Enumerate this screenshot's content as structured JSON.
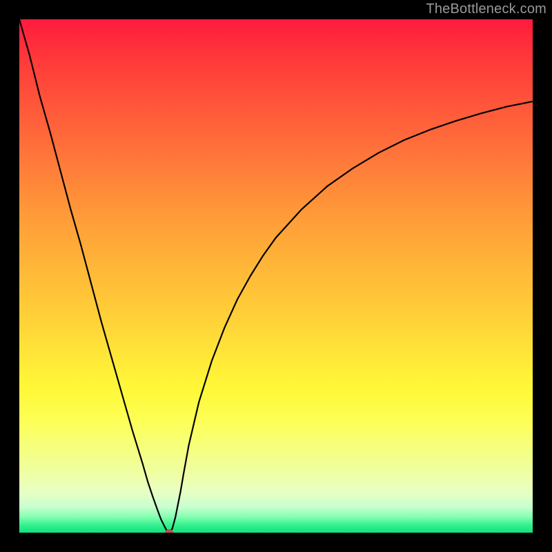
{
  "watermark": "TheBottleneck.com",
  "colors": {
    "frame": "#000000",
    "curve": "#000000",
    "dot": "#c05048"
  },
  "chart_data": {
    "type": "line",
    "title": "",
    "xlabel": "",
    "ylabel": "",
    "xlim": [
      0,
      100
    ],
    "ylim": [
      0,
      100
    ],
    "grid": false,
    "legend": false,
    "annotations": [
      {
        "type": "marker",
        "x": 29.2,
        "y": 0,
        "shape": "dot"
      }
    ],
    "series": [
      {
        "name": "curve",
        "x": [
          0.0,
          2.0,
          4.0,
          6.0,
          8.0,
          10.0,
          12.0,
          14.0,
          16.0,
          18.0,
          20.0,
          22.0,
          24.0,
          25.0,
          26.0,
          27.0,
          27.6,
          28.6,
          29.2,
          29.8,
          30.4,
          31.4,
          32.0,
          33.0,
          35.0,
          37.5,
          40.0,
          42.5,
          45.0,
          47.5,
          50.0,
          55.0,
          60.0,
          65.0,
          70.0,
          75.0,
          80.0,
          85.0,
          90.0,
          95.0,
          100.0
        ],
        "y": [
          100.0,
          93.0,
          85.0,
          78.0,
          70.5,
          63.0,
          56.0,
          48.5,
          41.0,
          34.0,
          27.0,
          20.0,
          13.5,
          10.0,
          7.0,
          4.2,
          2.6,
          0.6,
          0.0,
          0.8,
          3.0,
          8.0,
          11.5,
          17.0,
          25.5,
          33.5,
          40.0,
          45.5,
          50.0,
          54.0,
          57.5,
          63.0,
          67.5,
          71.0,
          74.0,
          76.5,
          78.5,
          80.2,
          81.7,
          83.0,
          84.0
        ]
      }
    ]
  }
}
